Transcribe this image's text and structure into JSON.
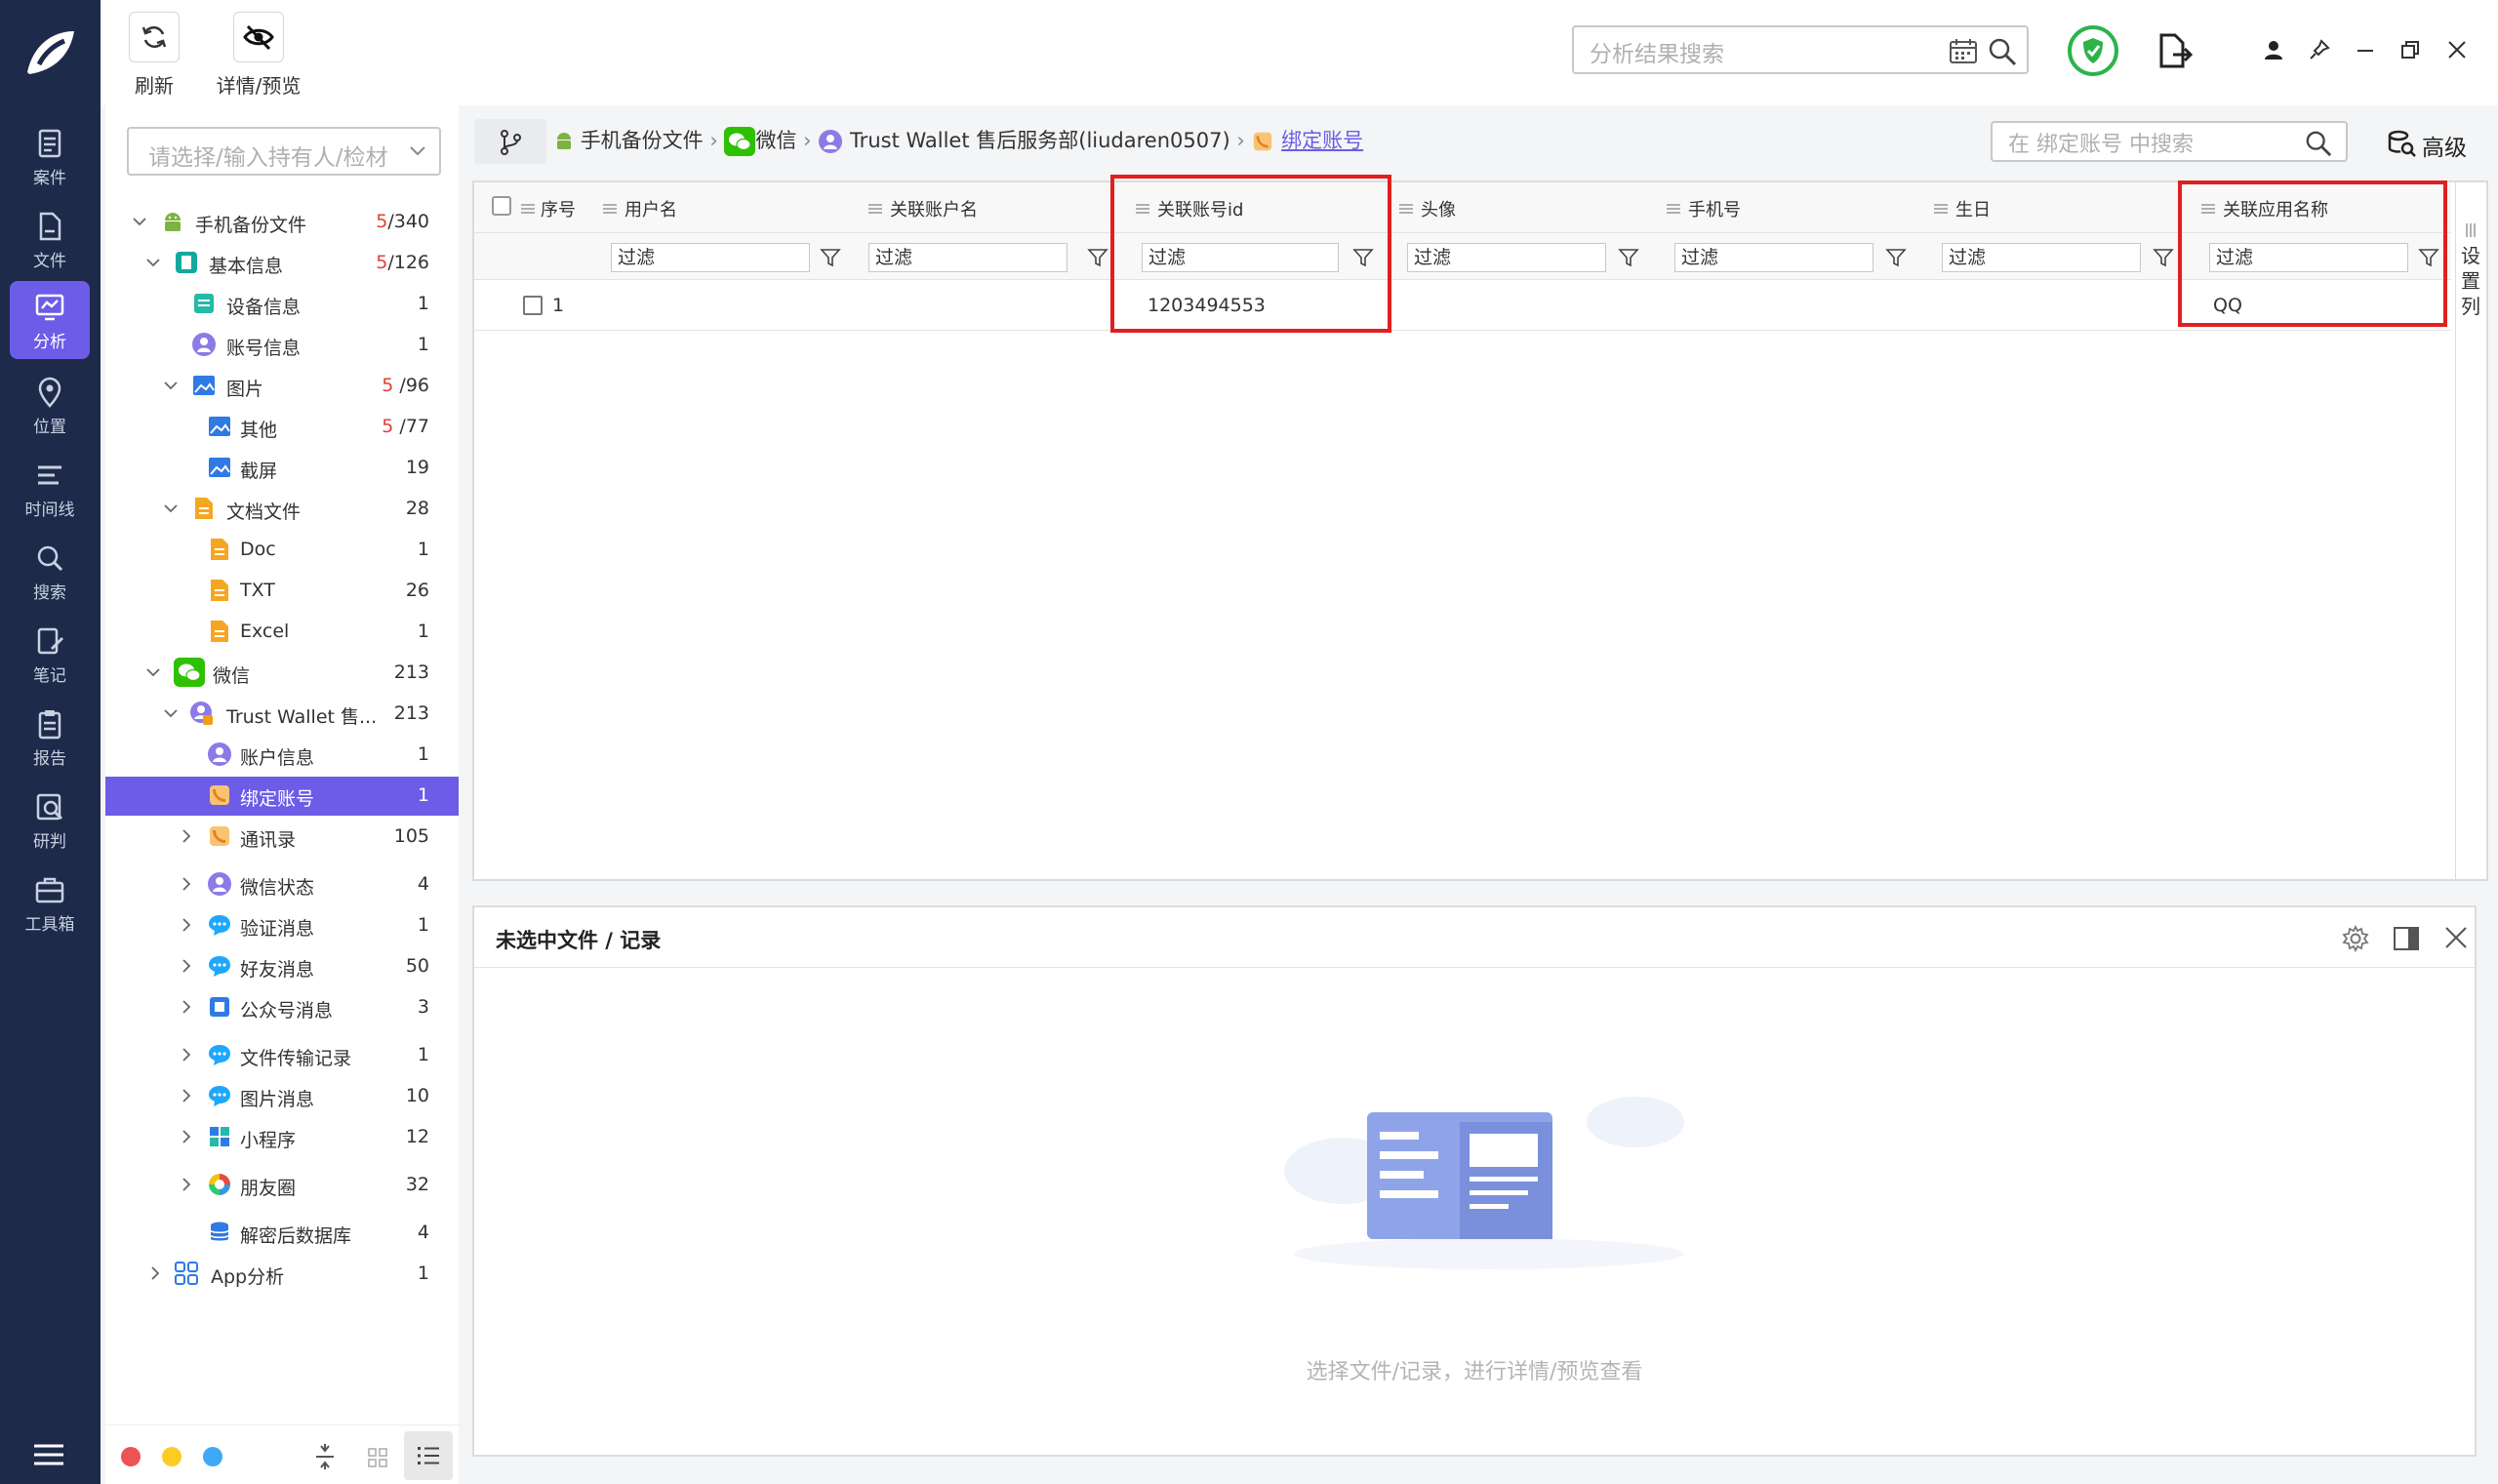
{
  "nav": {
    "items": [
      {
        "label": "案件"
      },
      {
        "label": "文件"
      },
      {
        "label": "分析"
      },
      {
        "label": "位置"
      },
      {
        "label": "时间线"
      },
      {
        "label": "搜索"
      },
      {
        "label": "笔记"
      },
      {
        "label": "报告"
      },
      {
        "label": "研判"
      },
      {
        "label": "工具箱"
      }
    ]
  },
  "toolbar": {
    "refresh_label": "刷新",
    "detail_label": "详情/预览",
    "search_placeholder": "分析结果搜索"
  },
  "sidetree": {
    "selector_placeholder": "请选择/输入持有人/检材",
    "rows": [
      {
        "label": "手机备份文件",
        "count_red": "5",
        "count": "/340"
      },
      {
        "label": "基本信息",
        "count_red": "5",
        "count": "/126"
      },
      {
        "label": "设备信息",
        "count_red": "",
        "count": "1"
      },
      {
        "label": "账号信息",
        "count_red": "",
        "count": "1"
      },
      {
        "label": "图片",
        "count_red": "5",
        "count": "  /96"
      },
      {
        "label": "其他",
        "count_red": "5",
        "count": "  /77"
      },
      {
        "label": "截屏",
        "count_red": "",
        "count": "19"
      },
      {
        "label": "文档文件",
        "count_red": "",
        "count": "28"
      },
      {
        "label": "Doc",
        "count_red": "",
        "count": "1"
      },
      {
        "label": "TXT",
        "count_red": "",
        "count": "26"
      },
      {
        "label": "Excel",
        "count_red": "",
        "count": "1"
      },
      {
        "label": "微信",
        "count_red": "",
        "count": "213"
      },
      {
        "label": "Trust Wallet 售...",
        "count_red": "",
        "count": "213"
      },
      {
        "label": "账户信息",
        "count_red": "",
        "count": "1"
      },
      {
        "label": "绑定账号",
        "count_red": "",
        "count": "1"
      },
      {
        "label": "通讯录",
        "count_red": "",
        "count": "105"
      },
      {
        "label": "微信状态",
        "count_red": "",
        "count": "4"
      },
      {
        "label": "验证消息",
        "count_red": "",
        "count": "1"
      },
      {
        "label": "好友消息",
        "count_red": "",
        "count": "50"
      },
      {
        "label": "公众号消息",
        "count_red": "",
        "count": "3"
      },
      {
        "label": "文件传输记录",
        "count_red": "",
        "count": "1"
      },
      {
        "label": "图片消息",
        "count_red": "",
        "count": "10"
      },
      {
        "label": "小程序",
        "count_red": "",
        "count": "12"
      },
      {
        "label": "朋友圈",
        "count_red": "",
        "count": "32"
      },
      {
        "label": "解密后数据库",
        "count_red": "",
        "count": "4"
      },
      {
        "label": "App分析",
        "count_red": "",
        "count": "1"
      }
    ]
  },
  "breadcrumb": {
    "items": [
      "手机备份文件",
      "微信",
      "Trust Wallet 售后服务部(liudaren0507)",
      "绑定账号"
    ],
    "search_placeholder": "在 绑定账号 中搜索",
    "advanced_label": "高级"
  },
  "grid": {
    "columns": [
      "序号",
      "用户名",
      "关联账户名",
      "关联账号id",
      "头像",
      "手机号",
      "生日",
      "关联应用名称"
    ],
    "filter_placeholder": "过滤",
    "settings_label": "设置列",
    "rows": [
      {
        "index": "1",
        "username": "",
        "account_name": "",
        "account_id": "1203494553",
        "avatar": "",
        "phone": "",
        "birthday": "",
        "app_name": "QQ"
      }
    ]
  },
  "preview": {
    "title": "未选中文件 / 记录",
    "empty_text": "选择文件/记录，进行详情/预览查看"
  },
  "colors": {
    "nav_bg": "#1e2a4a",
    "accent": "#6c5ce7",
    "highlight_box": "#e02020",
    "link": "#6c5ce7"
  }
}
